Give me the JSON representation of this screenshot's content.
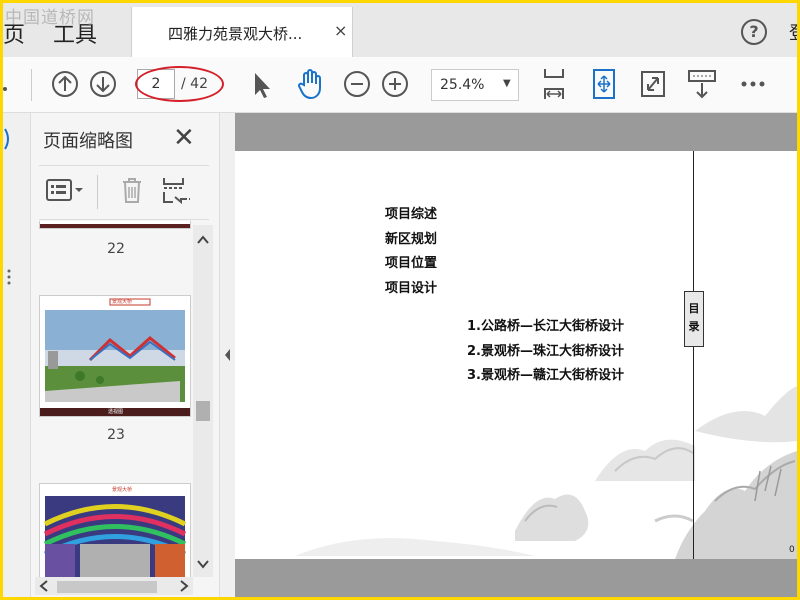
{
  "watermark": "中国道桥网",
  "menu": {
    "home_fragment": "页",
    "tools": "工具"
  },
  "tab": {
    "title": "四雅力苑景观大桥...",
    "close": "×"
  },
  "help": "?",
  "account_fragment": "登",
  "toolbar": {
    "page_current": "2",
    "page_total": "/ 42",
    "zoom": "25.4%"
  },
  "panel": {
    "title": "页面缩略图",
    "close": "✕",
    "thumbnails": [
      {
        "number": "22"
      },
      {
        "number": "23",
        "header": "景观大桥",
        "caption": "透视图"
      },
      {
        "header": "景观大桥"
      }
    ]
  },
  "document": {
    "toc_left": [
      "项目综述",
      "新区规划",
      "项目位置",
      "项目设计"
    ],
    "toc_right": [
      "1.公路桥—长江大街桥设计",
      "2.景观桥—珠江大街桥设计",
      "3.景观桥—赣江大街桥设计"
    ],
    "side_label": "目录",
    "edge_number": "0"
  },
  "colors": {
    "highlight": "#d4202a",
    "accent_blue": "#1a73c8"
  }
}
